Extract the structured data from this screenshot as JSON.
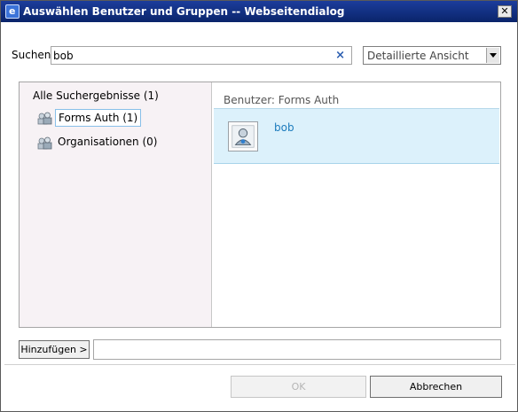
{
  "window": {
    "title": "Auswählen Benutzer und Gruppen -- Webseitendialog",
    "close_glyph": "✕",
    "title_icon_glyph": "e"
  },
  "search": {
    "label": "Suchen",
    "value": "bob",
    "clear_glyph": "×"
  },
  "view_select": {
    "selected": "Detaillierte Ansicht"
  },
  "left_pane": {
    "all_results": "Alle Suchergebnisse (1)",
    "providers": [
      {
        "label": "Forms Auth (1)",
        "icon": "users-group-icon"
      },
      {
        "label": "Organisationen (0)",
        "icon": "users-group-icon"
      }
    ]
  },
  "right_pane": {
    "group_header": "Benutzer: Forms Auth",
    "results": [
      {
        "name": "bob",
        "icon": "user-icon"
      }
    ]
  },
  "footer": {
    "add_label": "Hinzufügen >",
    "ok_label": "OK",
    "cancel_label": "Abbrechen"
  },
  "colors": {
    "titlebar": "#0a246a",
    "selection_bg": "#dcf1fb",
    "left_pane_bg": "#f7f2f5",
    "link": "#1c7bbd"
  }
}
